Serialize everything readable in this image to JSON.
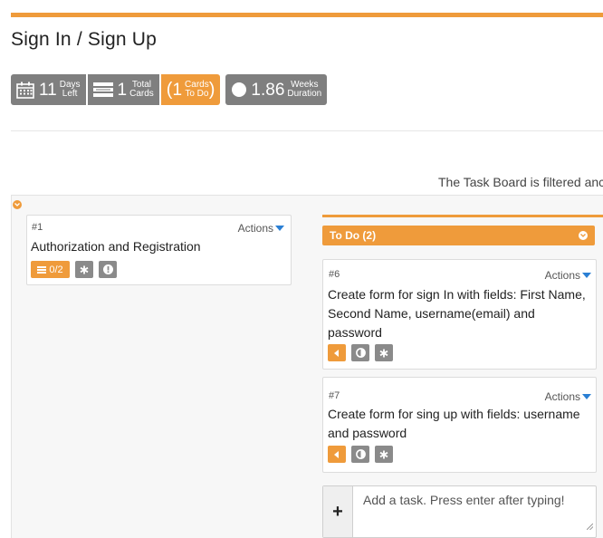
{
  "page": {
    "title": "Sign In / Sign Up"
  },
  "stats": {
    "days_left": {
      "value": "11",
      "label_line1": "Days",
      "label_line2": "Left",
      "icon": "calendar-icon"
    },
    "total_cards": {
      "value": "1",
      "label_line1": "Total",
      "label_line2": "Cards",
      "icon": "list-icon"
    },
    "cards_todo": {
      "open_paren": "(",
      "value": "1",
      "label_line1": "Cards",
      "label_line2": "To Do",
      "close_paren": ")"
    },
    "weeks_duration": {
      "value": "1.86",
      "label_line1": "Weeks",
      "label_line2": "Duration",
      "icon": "circle-icon"
    }
  },
  "filter_note": "The Task Board is filtered anc",
  "story": {
    "number": "#1",
    "actions_label": "Actions",
    "title": "Authorization and Registration",
    "tasks_badge": "0/2"
  },
  "column": {
    "title": "To Do (2)"
  },
  "tasks": [
    {
      "number": "#6",
      "actions_label": "Actions",
      "title_lines": [
        "Create form for sign In with fields: First Name,",
        "Second Name, username(email) and",
        "password"
      ]
    },
    {
      "number": "#7",
      "actions_label": "Actions",
      "title_lines": [
        "Create form for sing up with fields: username",
        "and password"
      ]
    }
  ],
  "add_task": {
    "placeholder": "Add a task. Press enter after typing!",
    "button_label": "+"
  },
  "colors": {
    "accent": "#ef9b3b",
    "gray_badge": "#7f7f7f",
    "link_blue": "#2a7fd4"
  }
}
